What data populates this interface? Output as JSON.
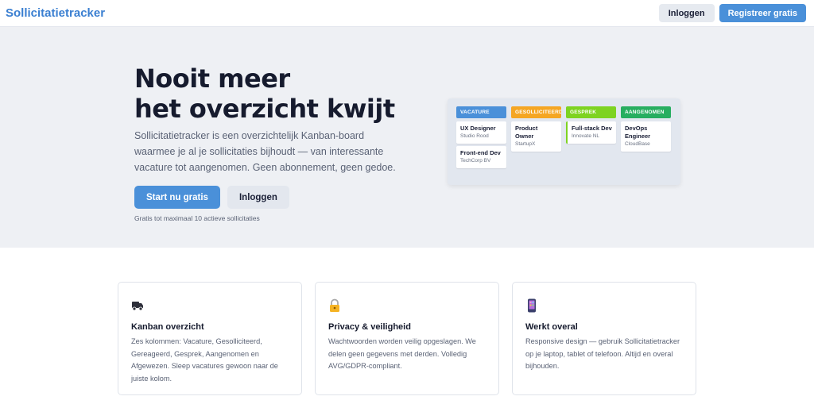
{
  "nav": {
    "brand": "Sollicitatietracker",
    "login_label": "Inloggen",
    "register_label": "Registreer gratis"
  },
  "hero": {
    "title_line1": "Nooit meer",
    "title_line2": "het overzicht kwijt",
    "description": "Sollicitatietracker is een overzichtelijk Kanban-board waarmee je al je sollicitaties bijhoudt — van interessante vacature tot aangenomen. Geen abonnement, geen gedoe.",
    "start_label": "Start nu gratis",
    "login_label": "Inloggen",
    "note": "Gratis tot maximaal 10 actieve sollicitaties"
  },
  "board": {
    "columns": [
      {
        "label": "VACATURE",
        "color": "#4a90d9",
        "cards": [
          {
            "title": "UX Designer",
            "company": "Studio Rood"
          },
          {
            "title": "Front-end Dev",
            "company": "TechCorp BV"
          }
        ]
      },
      {
        "label": "GESOLLICITEERD",
        "color": "#f5a623",
        "cards": [
          {
            "title": "Product Owner",
            "company": "StartupX"
          }
        ]
      },
      {
        "label": "GESPREK",
        "color": "#7ed321",
        "cards": [
          {
            "title": "Full-stack Dev",
            "company": "Innovate NL"
          }
        ]
      },
      {
        "label": "AANGENOMEN",
        "color": "#27ae60",
        "cards": [
          {
            "title": "DevOps Engineer",
            "company": "CloudBase"
          }
        ]
      }
    ]
  },
  "features": [
    {
      "icon": "truck-icon",
      "title": "Kanban overzicht",
      "text": "Zes kolommen: Vacature, Gesolliciteerd, Gereageerd, Gesprek, Aangenomen en Afgewezen. Sleep vacatures gewoon naar de juiste kolom."
    },
    {
      "icon": "lock-icon",
      "title": "Privacy & veiligheid",
      "text": "Wachtwoorden worden veilig opgeslagen. We delen geen gegevens met derden. Volledig AVG/GDPR-compliant."
    },
    {
      "icon": "phone-icon",
      "title": "Werkt overal",
      "text": "Responsive design — gebruik Sollicitatietracker op je laptop, tablet of telefoon. Altijd en overal bijhouden."
    }
  ]
}
